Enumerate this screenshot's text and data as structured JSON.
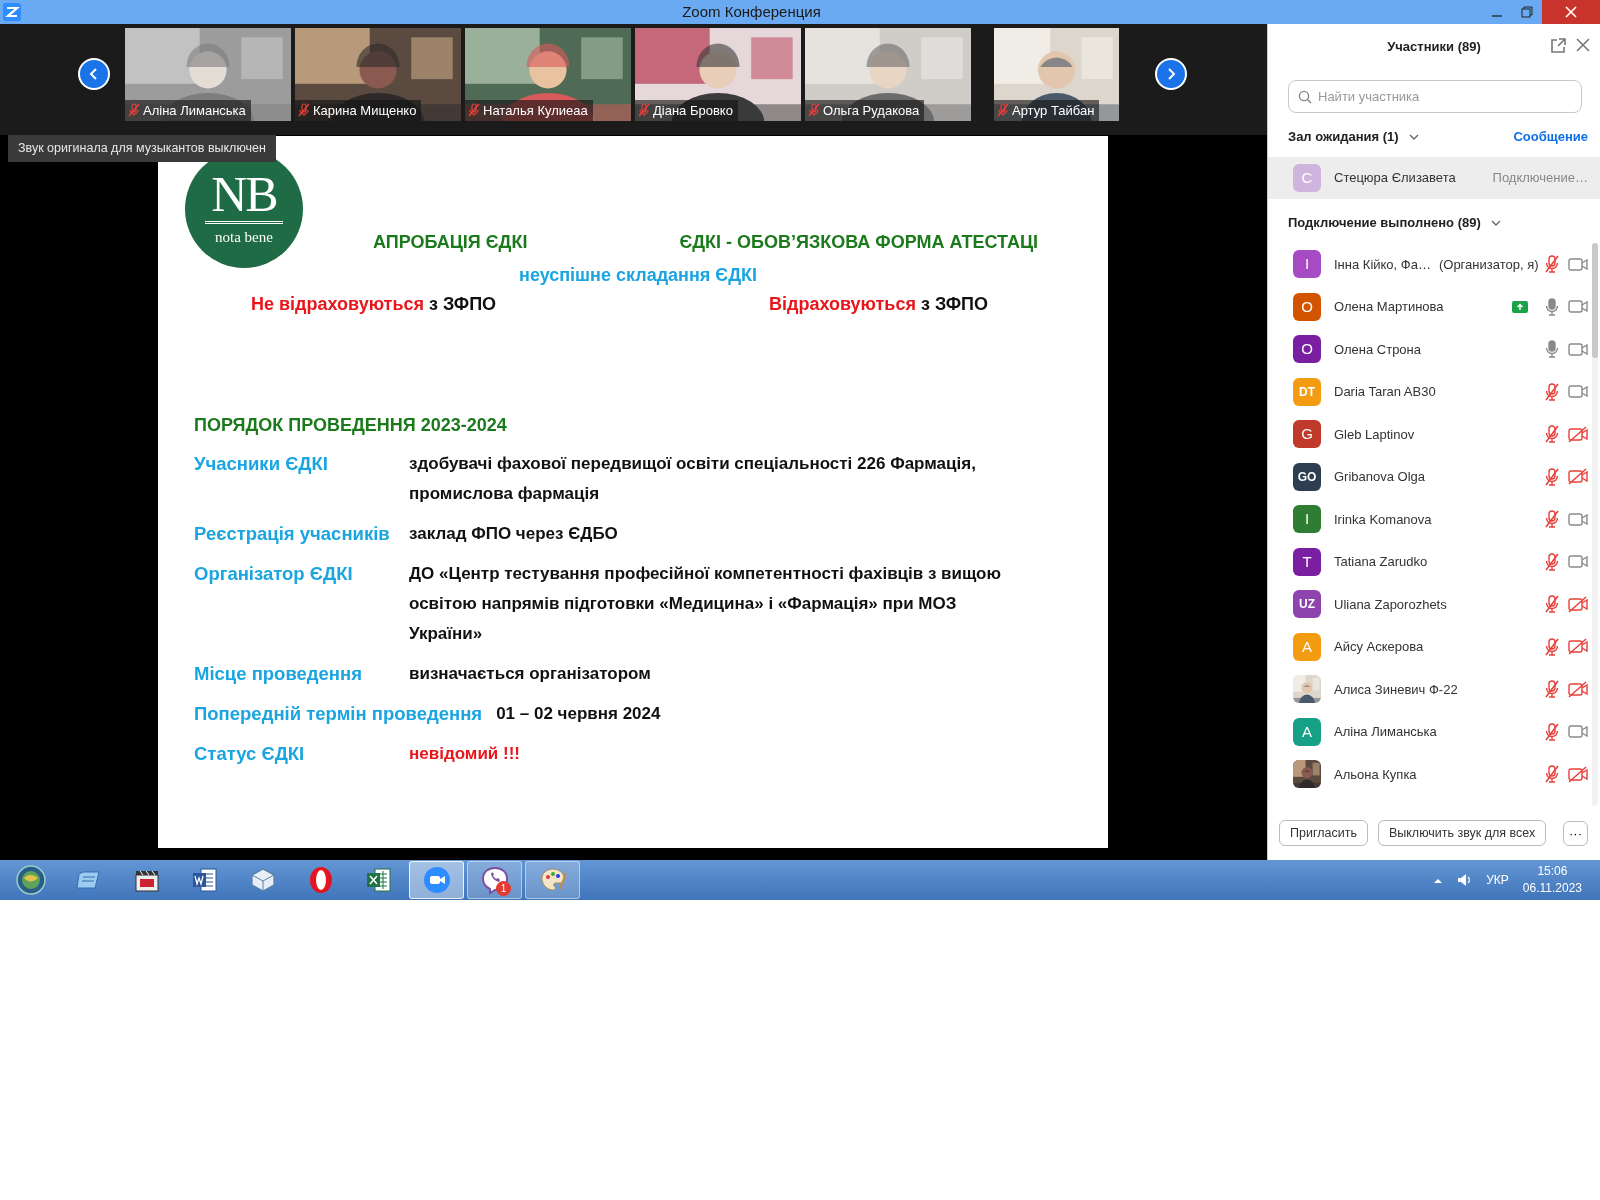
{
  "window": {
    "title": "Zoom Конференция"
  },
  "video_strip": {
    "tiles": [
      {
        "name": "Аліна Лиманська",
        "muted": true
      },
      {
        "name": "Карина Мищенко",
        "muted": true
      },
      {
        "name": "Наталья Кулиеаа",
        "muted": true
      },
      {
        "name": "Діана Бровко",
        "muted": true
      },
      {
        "name": "Ольга Рудакова",
        "muted": true
      },
      {
        "name": "Артур Тайбан",
        "muted": true
      }
    ]
  },
  "notice": "Звук оригинала для музыкантов выключен",
  "slide": {
    "logo": {
      "letters": "NB",
      "caption": "nota bene"
    },
    "headings": [
      "АПРОБАЦІЯ ЄДКІ",
      "ЄДКІ - ОБОВ’ЯЗКОВА ФОРМА АТЕСТАЦІ"
    ],
    "subtitle": "неуспішне складання ЄДКІ",
    "outcomes": [
      {
        "verdict": "Не відраховуються",
        "rest": "з ЗФПО"
      },
      {
        "verdict": "Відраховуються",
        "rest": "з ЗФПО"
      }
    ],
    "section_title": "ПОРЯДОК ПРОВЕДЕННЯ 2023-2024",
    "rows": [
      {
        "label": "Учасники ЄДКІ",
        "value": "здобувачі фахової передвищої освіти спеціальності 226 Фармація, промислова  фармація",
        "kind": "plain"
      },
      {
        "label": "Реєстрація учасників",
        "value": "заклад ФПО через ЄДБО",
        "kind": "plain"
      },
      {
        "label": "Організатор ЄДКІ",
        "value": "ДО «Центр тестування професійної компетентності фахівців з вищою освітою напрямів підготовки «Медицина» і «Фармація» при МОЗ України»",
        "kind": "plain"
      },
      {
        "label": "Місце проведення",
        "value": "визначається організатором",
        "kind": "plain"
      },
      {
        "label": "Попередній термін проведення",
        "value": "01 – 02 червня  2024",
        "kind": "plain"
      },
      {
        "label": "Статус ЄДКІ",
        "value": "невідомий !!!",
        "kind": "alert"
      }
    ]
  },
  "participants": {
    "title": "Участники (89)",
    "search": {
      "placeholder": "Найти участника"
    },
    "waiting": {
      "title": "Зал ожидания (1)",
      "expanded": true,
      "action": "Сообщение",
      "people": [
        {
          "initials": "C",
          "color": "#cfb4de",
          "name": "Стецюра Єлизавета",
          "status": "Подключение…"
        }
      ]
    },
    "connected": {
      "title": "Подключение выполнено (89)",
      "expanded": true,
      "people": [
        {
          "initials": "I",
          "color": "#a64bc2",
          "name": "Інна Кійко, Фа…",
          "role": "(Организатор, я)",
          "muted": true,
          "video_on": true,
          "sharing": false
        },
        {
          "initials": "O",
          "color": "#d35400",
          "name": "Олена Мартинова",
          "muted": false,
          "video_on": true,
          "sharing": true
        },
        {
          "initials": "O",
          "color": "#7b1fa2",
          "name": "Олена Строна",
          "muted": false,
          "video_on": true,
          "sharing": false
        },
        {
          "initials": "DT",
          "color": "#f39c12",
          "name": "Daria Taran AB30",
          "muted": true,
          "video_on": true,
          "sharing": false
        },
        {
          "initials": "G",
          "color": "#c0392b",
          "name": "Gleb Laptinov",
          "muted": true,
          "video_on": false,
          "sharing": false
        },
        {
          "initials": "GO",
          "color": "#2c3e50",
          "name": "Gribanova Olga",
          "muted": true,
          "video_on": false,
          "sharing": false
        },
        {
          "initials": "I",
          "color": "#2e7d32",
          "name": "Irinka Komanova",
          "muted": true,
          "video_on": true,
          "sharing": false
        },
        {
          "initials": "T",
          "color": "#7b1fa2",
          "name": "Tatiana Zarudko",
          "muted": true,
          "video_on": true,
          "sharing": false
        },
        {
          "initials": "UZ",
          "color": "#8e44ad",
          "name": "Uliana Zaporozhets",
          "muted": true,
          "video_on": false,
          "sharing": false
        },
        {
          "initials": "A",
          "color": "#f39c12",
          "name": "Айсу Аскерова",
          "muted": true,
          "video_on": false,
          "sharing": false
        },
        {
          "name": "Алиса Зиневич Ф-22",
          "muted": true,
          "video_on": false,
          "sharing": false
        },
        {
          "initials": "A",
          "color": "#16a085",
          "name": "Аліна Лиманська",
          "muted": true,
          "video_on": true,
          "sharing": false
        },
        {
          "name": "Альона Купка",
          "muted": true,
          "video_on": false,
          "sharing": false
        }
      ]
    },
    "buttons": [
      "Пригласить",
      "Выключить звук для всех"
    ],
    "more": "···"
  },
  "taskbar": {
    "apps": [
      {
        "kind": "start",
        "running": false,
        "selected": false
      },
      {
        "kind": "explorer",
        "running": false,
        "selected": false
      },
      {
        "kind": "media",
        "running": false,
        "selected": false
      },
      {
        "kind": "word",
        "running": false,
        "selected": false
      },
      {
        "kind": "box",
        "running": false,
        "selected": false
      },
      {
        "kind": "opera",
        "running": false,
        "selected": false
      },
      {
        "kind": "excel",
        "running": false,
        "selected": false
      },
      {
        "kind": "zoom",
        "running": true,
        "selected": true
      },
      {
        "kind": "viber",
        "running": true,
        "selected": false,
        "badge": "1"
      },
      {
        "kind": "paint",
        "running": true,
        "selected": false
      }
    ],
    "language": "УКР",
    "time": "15:06",
    "date": "06.11.2023"
  }
}
